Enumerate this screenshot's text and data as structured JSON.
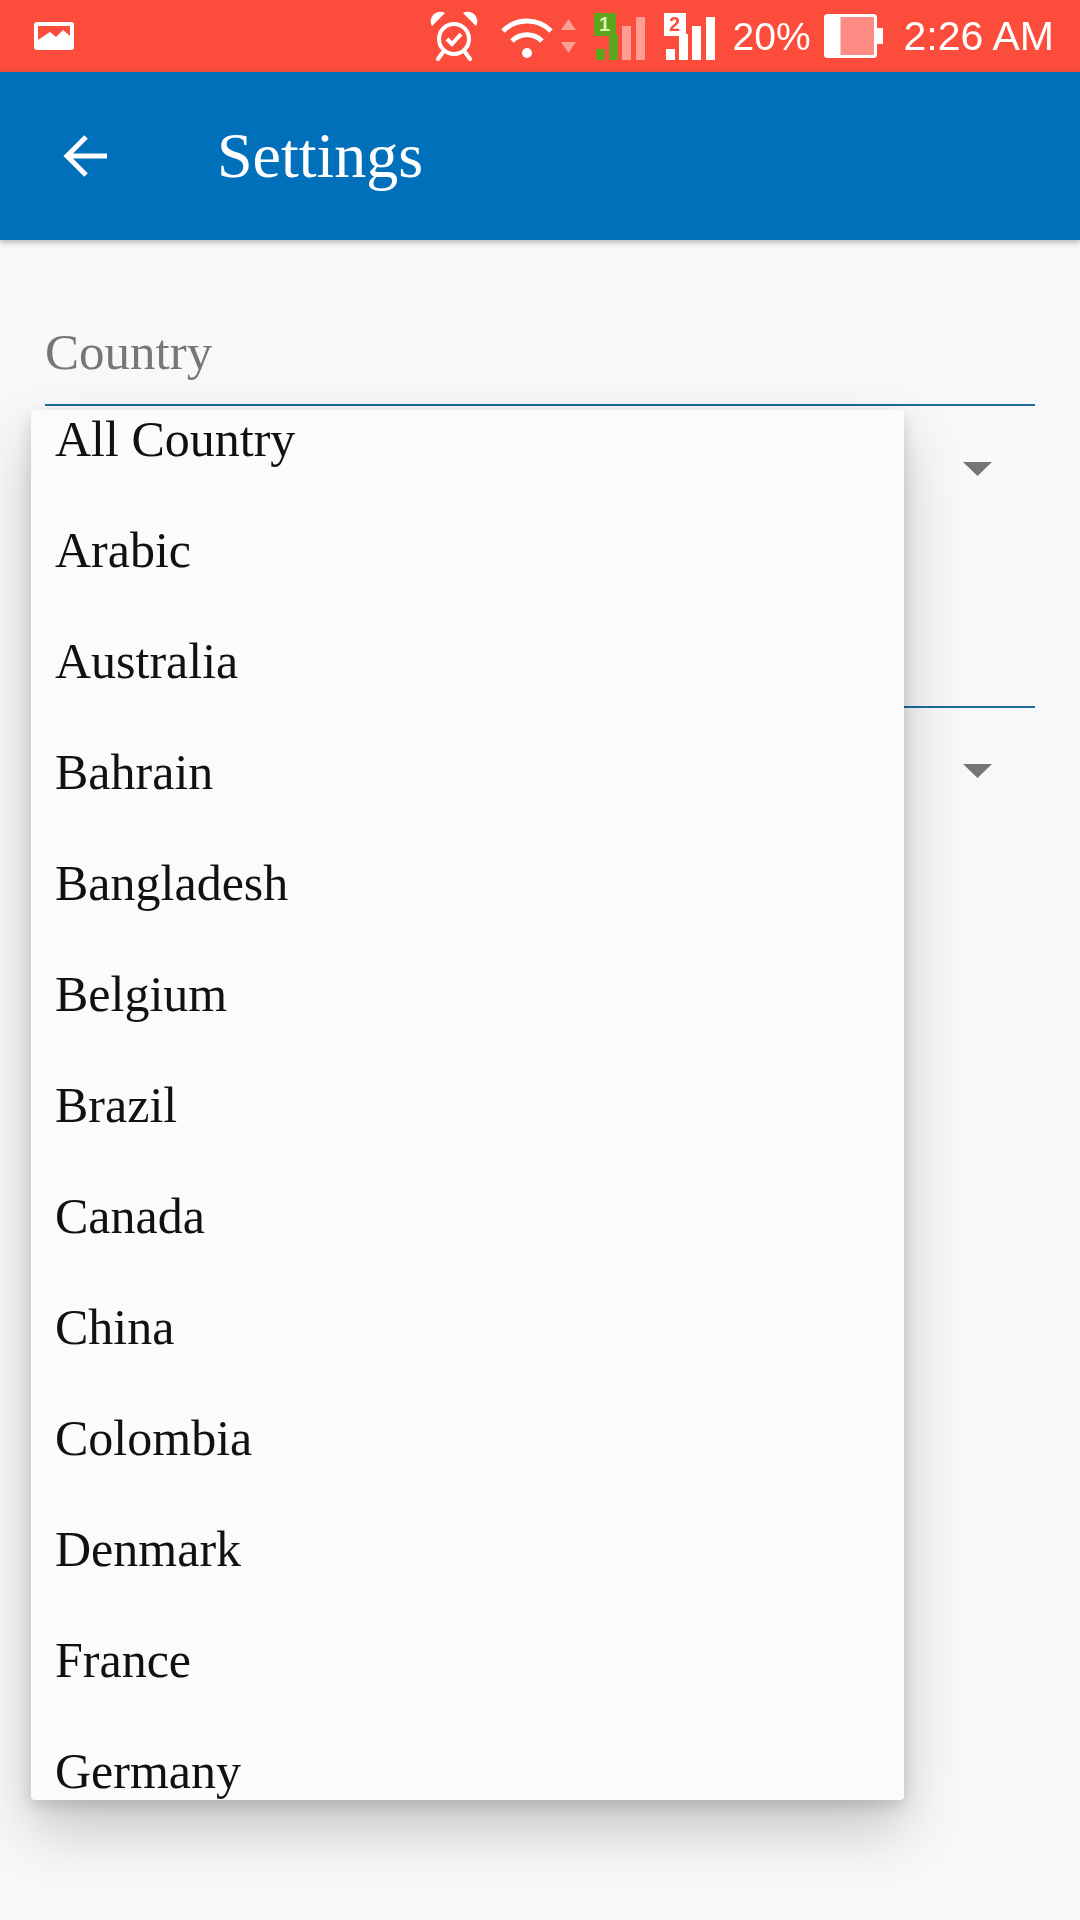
{
  "status_bar": {
    "sim_slots": [
      {
        "label": "1",
        "selected": true
      },
      {
        "label": "2",
        "selected": false
      }
    ],
    "battery_text": "20%",
    "time": "2:26 AM"
  },
  "app_bar": {
    "title": "Settings"
  },
  "form": {
    "fields": [
      {
        "kind": "dropdown",
        "label": "Country"
      },
      {
        "kind": "dropdown"
      }
    ]
  },
  "dropdown_menu": {
    "items": [
      {
        "label": "All Country"
      },
      {
        "label": "Arabic"
      },
      {
        "label": "Australia"
      },
      {
        "label": "Bahrain"
      },
      {
        "label": "Bangladesh"
      },
      {
        "label": "Belgium"
      },
      {
        "label": "Brazil"
      },
      {
        "label": "Canada"
      },
      {
        "label": "China"
      },
      {
        "label": "Colombia"
      },
      {
        "label": "Denmark"
      },
      {
        "label": "France"
      },
      {
        "label": "Germany"
      }
    ]
  }
}
